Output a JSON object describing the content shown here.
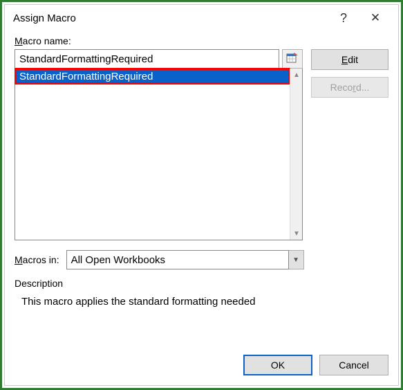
{
  "titlebar": {
    "title": "Assign Macro"
  },
  "labels": {
    "macro_name": "acro name:",
    "macro_name_u": "M",
    "macros_in": "acros in:",
    "macros_in_u": "M",
    "description": "Description"
  },
  "input": {
    "macro_name_value": "StandardFormattingRequired"
  },
  "list": {
    "items": [
      "StandardFormattingRequired"
    ],
    "selected_index": 0
  },
  "macros_in": {
    "selected": "All Open Workbooks"
  },
  "description_text": "This macro applies the standard formatting needed",
  "buttons": {
    "edit_pre": "",
    "edit_u": "E",
    "edit_post": "dit",
    "record_pre": "Reco",
    "record_u": "r",
    "record_post": "d...",
    "ok": "OK",
    "cancel": "Cancel"
  }
}
